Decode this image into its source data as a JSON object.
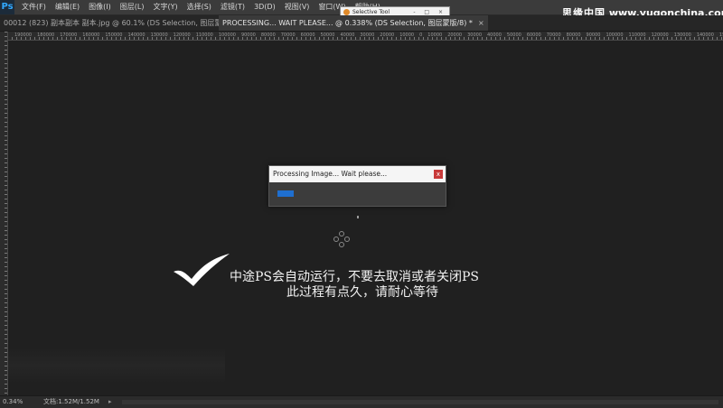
{
  "app": {
    "logo": "Ps"
  },
  "menu": [
    "文件(F)",
    "编辑(E)",
    "图像(I)",
    "图层(L)",
    "文字(Y)",
    "选择(S)",
    "滤镜(T)",
    "3D(D)",
    "视图(V)",
    "窗口(W)",
    "帮助(H)"
  ],
  "tabs": [
    {
      "label": "00012 (823) 副本副本 副本.jpg @ 60.1% (DS Selection, 图层蒙版/8) *",
      "close": "×"
    },
    {
      "label": "PROCESSING... WAIT PLEASE... @ 0.338% (DS Selection, 图层蒙版/8) *",
      "close": "×"
    }
  ],
  "selective_tool": {
    "title": "Selective Tool",
    "buttons": "- □ ×"
  },
  "ruler_labels": [
    "190000",
    "180000",
    "170000",
    "160000",
    "150000",
    "140000",
    "130000",
    "120000",
    "110000",
    "100000",
    "90000",
    "80000",
    "70000",
    "60000",
    "50000",
    "40000",
    "30000",
    "20000",
    "10000",
    "0",
    "10000",
    "20000",
    "30000",
    "40000",
    "50000",
    "60000",
    "70000",
    "80000",
    "90000",
    "100000",
    "110000",
    "120000",
    "130000",
    "140000",
    "150000",
    "160000",
    "170000",
    "180000",
    "190000"
  ],
  "dialog": {
    "title": "Processing Image... Wait please...",
    "close": "x",
    "progress": 0.1
  },
  "caption": {
    "line1": "中途PS会自动运行，不要去取消或者关闭PS",
    "line2": "此过程有点久，请耐心等待"
  },
  "status": {
    "zoom": "0.34%",
    "doc": "文档:1.52M/1.52M",
    "arrow": "▸"
  },
  "watermark": {
    "logo": "思缘中国",
    "url": "www.yugonchina.com"
  },
  "colors": {
    "progress": "#1f6fd0",
    "close": "#c83a3a",
    "ps_blue": "#31a8ff"
  }
}
